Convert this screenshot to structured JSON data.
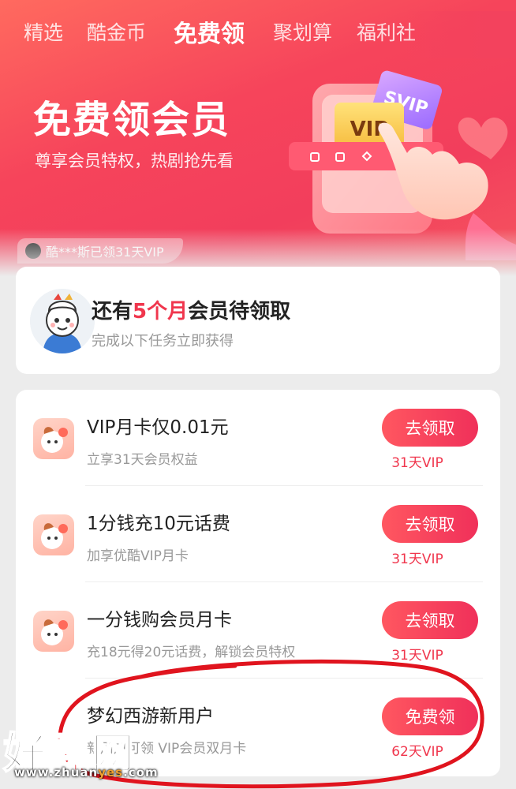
{
  "tabs": [
    {
      "label": "精选"
    },
    {
      "label": "酷金币"
    },
    {
      "label": "免费领",
      "active": true
    },
    {
      "label": "聚划算"
    },
    {
      "label": "福利社"
    }
  ],
  "hero": {
    "title": "免费领会员",
    "subtitle": "尊享会员特权，热剧抢先看",
    "card_front": "VIP",
    "card_back": "SVIP"
  },
  "ticker": "酷***斯已领31天VIP",
  "pending": {
    "title_prefix": "还有",
    "title_highlight": "5个月",
    "title_suffix": "会员待领取",
    "subtitle": "完成以下任务立即获得"
  },
  "tasks": [
    {
      "title": "VIP月卡仅0.01元",
      "subtitle": "立享31天会员权益",
      "button": "去领取",
      "reward": "31天VIP"
    },
    {
      "title": "1分钱充10元话费",
      "subtitle": "加享优酷VIP月卡",
      "button": "去领取",
      "reward": "31天VIP"
    },
    {
      "title": "一分钱购会员月卡",
      "subtitle": "充18元得20元话费，解锁会员特权",
      "button": "去领取",
      "reward": "31天VIP"
    },
    {
      "title": "梦幻西游新用户",
      "subtitle": "新用户可领 VIP会员双月卡",
      "button": "免费领",
      "reward": "62天VIP"
    }
  ],
  "watermark": {
    "main": "好赚网",
    "url_a": "www.zhuan",
    "url_b": "yes",
    "url_c": ".com"
  },
  "colors": {
    "brand_red": "#f0364d",
    "hero_gradient_start": "#ff6a5f",
    "hero_gradient_end": "#f23e5c"
  }
}
